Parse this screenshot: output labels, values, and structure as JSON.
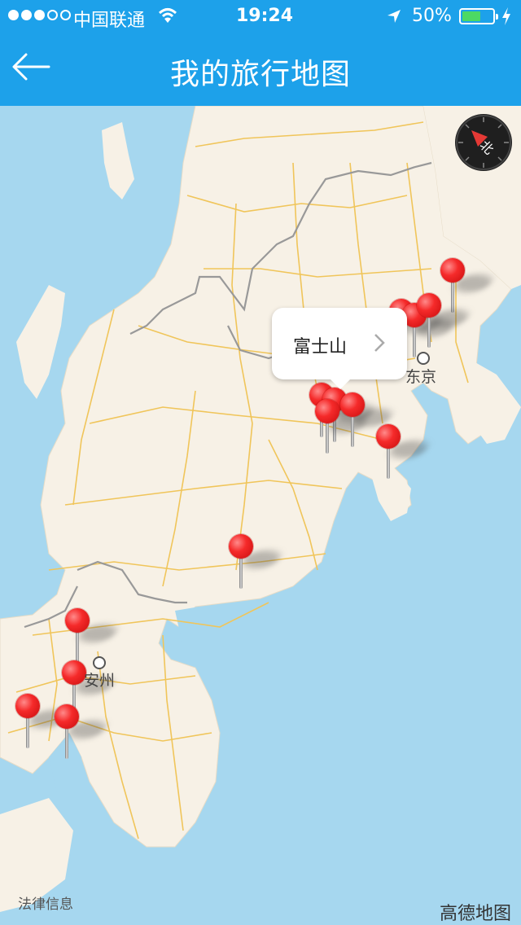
{
  "status_bar": {
    "carrier": "中国联通",
    "time": "19:24",
    "battery_percent": "50%",
    "battery_level": 0.5,
    "signal_bars_filled": 3,
    "signal_bars_total": 5
  },
  "header": {
    "title": "我的旅行地图",
    "back_icon": "back-arrow-icon",
    "background_color": "#1da1ea"
  },
  "map": {
    "callout": {
      "label": "富士山"
    },
    "cities": [
      {
        "name": "东京"
      },
      {
        "name": "安州"
      }
    ],
    "compass_label": "北",
    "legal_link": "法律信息",
    "brand": "高德地图",
    "pin_color": "#f52a2a",
    "pin_count": 15,
    "water_color": "#a6d7ef",
    "land_color": "#f7f1e6"
  }
}
